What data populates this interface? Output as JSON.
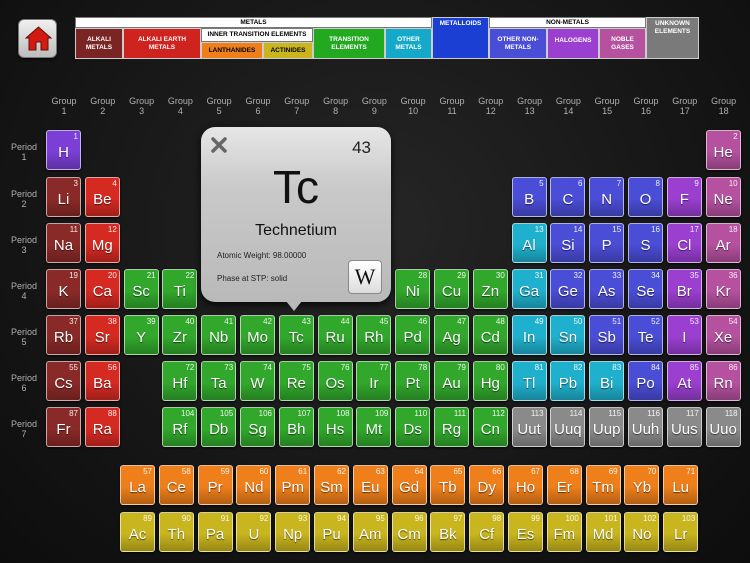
{
  "legend": {
    "metals_label": "METALS",
    "inner_transition_label": "INNER TRANSITION ELEMENTS",
    "metalloids_label": "METALLOIDS",
    "non_metals_label": "NON-METALS",
    "unknown_label": "UNKNOWN ELEMENTS",
    "alkali_metals": "ALKALI METALS",
    "alkali_earth_metals": "ALKALI EARTH METALS",
    "lanthanides": "LANTHANIDES",
    "actinides": "ACTINIDES",
    "transition_elements": "TRANSITION ELEMENTS",
    "other_metals": "OTHER METALS",
    "other_non_metals": "OTHER NON-METALS",
    "halogens": "HALOGENS",
    "noble_gases": "NOBLE GASES"
  },
  "group_label": "Group",
  "period_label": "Period",
  "popup": {
    "number": "43",
    "symbol": "Tc",
    "name": "Technetium",
    "atomic_weight": "Atomic Weight: 98.00000",
    "phase": "Phase at STP: solid",
    "wiki_label": "W"
  },
  "colors": {
    "alkali": "#8a2a28",
    "alkali_earth": "#d42a22",
    "transition": "#31a82c",
    "other_metal": "#1fb0cd",
    "other_non_metal": "#4a4dd6",
    "halogen": "#9a3fd0",
    "noble": "#b5519f",
    "lanthanide": "#ee7f1a",
    "actinide": "#c9b51d",
    "metalloid": "#1b3fd2",
    "unknown": "#8a8a8a",
    "hydrogen": "#7b3fd6"
  },
  "elements": [
    {
      "n": "1",
      "s": "H",
      "c": "hydrogen"
    },
    {
      "n": "2",
      "s": "He",
      "c": "noble"
    },
    {
      "n": "3",
      "s": "Li",
      "c": "alkali"
    },
    {
      "n": "4",
      "s": "Be",
      "c": "alkali_earth"
    },
    {
      "n": "5",
      "s": "B",
      "c": "other_non_metal"
    },
    {
      "n": "6",
      "s": "C",
      "c": "other_non_metal"
    },
    {
      "n": "7",
      "s": "N",
      "c": "other_non_metal"
    },
    {
      "n": "8",
      "s": "O",
      "c": "other_non_metal"
    },
    {
      "n": "9",
      "s": "F",
      "c": "halogen"
    },
    {
      "n": "10",
      "s": "Ne",
      "c": "noble"
    },
    {
      "n": "11",
      "s": "Na",
      "c": "alkali"
    },
    {
      "n": "12",
      "s": "Mg",
      "c": "alkali_earth"
    },
    {
      "n": "13",
      "s": "Al",
      "c": "other_metal"
    },
    {
      "n": "14",
      "s": "Si",
      "c": "other_non_metal"
    },
    {
      "n": "15",
      "s": "P",
      "c": "other_non_metal"
    },
    {
      "n": "16",
      "s": "S",
      "c": "other_non_metal"
    },
    {
      "n": "17",
      "s": "Cl",
      "c": "halogen"
    },
    {
      "n": "18",
      "s": "Ar",
      "c": "noble"
    },
    {
      "n": "19",
      "s": "K",
      "c": "alkali"
    },
    {
      "n": "20",
      "s": "Ca",
      "c": "alkali_earth"
    },
    {
      "n": "21",
      "s": "Sc",
      "c": "transition"
    },
    {
      "n": "22",
      "s": "Ti",
      "c": "transition"
    },
    {
      "n": "28",
      "s": "Ni",
      "c": "transition"
    },
    {
      "n": "29",
      "s": "Cu",
      "c": "transition"
    },
    {
      "n": "30",
      "s": "Zn",
      "c": "transition"
    },
    {
      "n": "31",
      "s": "Ga",
      "c": "other_metal"
    },
    {
      "n": "32",
      "s": "Ge",
      "c": "other_non_metal"
    },
    {
      "n": "33",
      "s": "As",
      "c": "other_non_metal"
    },
    {
      "n": "34",
      "s": "Se",
      "c": "other_non_metal"
    },
    {
      "n": "35",
      "s": "Br",
      "c": "halogen"
    },
    {
      "n": "36",
      "s": "Kr",
      "c": "noble"
    },
    {
      "n": "37",
      "s": "Rb",
      "c": "alkali"
    },
    {
      "n": "38",
      "s": "Sr",
      "c": "alkali_earth"
    },
    {
      "n": "39",
      "s": "Y",
      "c": "transition"
    },
    {
      "n": "40",
      "s": "Zr",
      "c": "transition"
    },
    {
      "n": "41",
      "s": "Nb",
      "c": "transition"
    },
    {
      "n": "42",
      "s": "Mo",
      "c": "transition"
    },
    {
      "n": "43",
      "s": "Tc",
      "c": "transition"
    },
    {
      "n": "44",
      "s": "Ru",
      "c": "transition"
    },
    {
      "n": "45",
      "s": "Rh",
      "c": "transition"
    },
    {
      "n": "46",
      "s": "Pd",
      "c": "transition"
    },
    {
      "n": "47",
      "s": "Ag",
      "c": "transition"
    },
    {
      "n": "48",
      "s": "Cd",
      "c": "transition"
    },
    {
      "n": "49",
      "s": "In",
      "c": "other_metal"
    },
    {
      "n": "50",
      "s": "Sn",
      "c": "other_metal"
    },
    {
      "n": "51",
      "s": "Sb",
      "c": "other_non_metal"
    },
    {
      "n": "52",
      "s": "Te",
      "c": "other_non_metal"
    },
    {
      "n": "53",
      "s": "I",
      "c": "halogen"
    },
    {
      "n": "54",
      "s": "Xe",
      "c": "noble"
    },
    {
      "n": "55",
      "s": "Cs",
      "c": "alkali"
    },
    {
      "n": "56",
      "s": "Ba",
      "c": "alkali_earth"
    },
    {
      "n": "72",
      "s": "Hf",
      "c": "transition"
    },
    {
      "n": "73",
      "s": "Ta",
      "c": "transition"
    },
    {
      "n": "74",
      "s": "W",
      "c": "transition"
    },
    {
      "n": "75",
      "s": "Re",
      "c": "transition"
    },
    {
      "n": "76",
      "s": "Os",
      "c": "transition"
    },
    {
      "n": "77",
      "s": "Ir",
      "c": "transition"
    },
    {
      "n": "78",
      "s": "Pt",
      "c": "transition"
    },
    {
      "n": "79",
      "s": "Au",
      "c": "transition"
    },
    {
      "n": "80",
      "s": "Hg",
      "c": "transition"
    },
    {
      "n": "81",
      "s": "Tl",
      "c": "other_metal"
    },
    {
      "n": "82",
      "s": "Pb",
      "c": "other_metal"
    },
    {
      "n": "83",
      "s": "Bi",
      "c": "other_metal"
    },
    {
      "n": "84",
      "s": "Po",
      "c": "other_non_metal"
    },
    {
      "n": "85",
      "s": "At",
      "c": "halogen"
    },
    {
      "n": "86",
      "s": "Rn",
      "c": "noble"
    },
    {
      "n": "87",
      "s": "Fr",
      "c": "alkali"
    },
    {
      "n": "88",
      "s": "Ra",
      "c": "alkali_earth"
    },
    {
      "n": "104",
      "s": "Rf",
      "c": "transition"
    },
    {
      "n": "105",
      "s": "Db",
      "c": "transition"
    },
    {
      "n": "106",
      "s": "Sg",
      "c": "transition"
    },
    {
      "n": "107",
      "s": "Bh",
      "c": "transition"
    },
    {
      "n": "108",
      "s": "Hs",
      "c": "transition"
    },
    {
      "n": "109",
      "s": "Mt",
      "c": "transition"
    },
    {
      "n": "110",
      "s": "Ds",
      "c": "transition"
    },
    {
      "n": "111",
      "s": "Rg",
      "c": "transition"
    },
    {
      "n": "112",
      "s": "Cn",
      "c": "transition"
    },
    {
      "n": "113",
      "s": "Uut",
      "c": "unknown"
    },
    {
      "n": "114",
      "s": "Uuq",
      "c": "unknown"
    },
    {
      "n": "115",
      "s": "Uup",
      "c": "unknown"
    },
    {
      "n": "116",
      "s": "Uuh",
      "c": "unknown"
    },
    {
      "n": "117",
      "s": "Uus",
      "c": "unknown"
    },
    {
      "n": "118",
      "s": "Uuo",
      "c": "unknown"
    },
    {
      "n": "57",
      "s": "La",
      "c": "lanthanide"
    },
    {
      "n": "58",
      "s": "Ce",
      "c": "lanthanide"
    },
    {
      "n": "59",
      "s": "Pr",
      "c": "lanthanide"
    },
    {
      "n": "60",
      "s": "Nd",
      "c": "lanthanide"
    },
    {
      "n": "61",
      "s": "Pm",
      "c": "lanthanide"
    },
    {
      "n": "62",
      "s": "Sm",
      "c": "lanthanide"
    },
    {
      "n": "63",
      "s": "Eu",
      "c": "lanthanide"
    },
    {
      "n": "64",
      "s": "Gd",
      "c": "lanthanide"
    },
    {
      "n": "65",
      "s": "Tb",
      "c": "lanthanide"
    },
    {
      "n": "66",
      "s": "Dy",
      "c": "lanthanide"
    },
    {
      "n": "67",
      "s": "Ho",
      "c": "lanthanide"
    },
    {
      "n": "68",
      "s": "Er",
      "c": "lanthanide"
    },
    {
      "n": "69",
      "s": "Tm",
      "c": "lanthanide"
    },
    {
      "n": "70",
      "s": "Yb",
      "c": "lanthanide"
    },
    {
      "n": "71",
      "s": "Lu",
      "c": "lanthanide"
    },
    {
      "n": "89",
      "s": "Ac",
      "c": "actinide"
    },
    {
      "n": "90",
      "s": "Th",
      "c": "actinide"
    },
    {
      "n": "91",
      "s": "Pa",
      "c": "actinide"
    },
    {
      "n": "92",
      "s": "U",
      "c": "actinide"
    },
    {
      "n": "93",
      "s": "Np",
      "c": "actinide"
    },
    {
      "n": "94",
      "s": "Pu",
      "c": "actinide"
    },
    {
      "n": "95",
      "s": "Am",
      "c": "actinide"
    },
    {
      "n": "96",
      "s": "Cm",
      "c": "actinide"
    },
    {
      "n": "97",
      "s": "Bk",
      "c": "actinide"
    },
    {
      "n": "98",
      "s": "Cf",
      "c": "actinide"
    },
    {
      "n": "99",
      "s": "Es",
      "c": "actinide"
    },
    {
      "n": "100",
      "s": "Fm",
      "c": "actinide"
    },
    {
      "n": "101",
      "s": "Md",
      "c": "actinide"
    },
    {
      "n": "102",
      "s": "No",
      "c": "actinide"
    },
    {
      "n": "103",
      "s": "Lr",
      "c": "actinide"
    }
  ]
}
